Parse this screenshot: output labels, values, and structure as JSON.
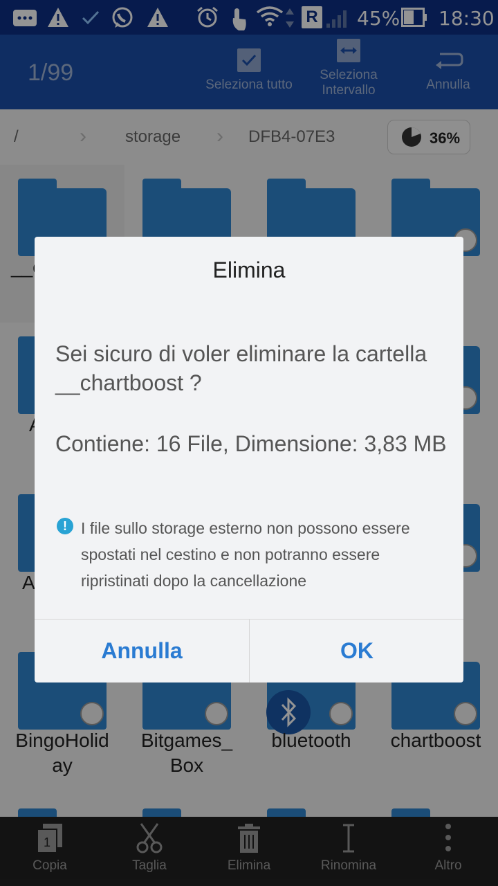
{
  "status_bar": {
    "battery": "45%",
    "time": "18:30",
    "roaming": "R",
    "icons": [
      "message-icon",
      "warning-icon",
      "check-icon",
      "whatsapp-icon",
      "warning-icon",
      "alarm-icon",
      "touch-icon",
      "wifi-icon",
      "roaming-icon",
      "signal-icon",
      "battery-icon"
    ]
  },
  "toolbar": {
    "counter": "1/99",
    "select_all": "Seleziona tutto",
    "select_range_line1": "Seleziona",
    "select_range_line2": "Intervallo",
    "cancel": "Annulla"
  },
  "breadcrumb": {
    "root": "/",
    "items": [
      "storage",
      "DFB4-07E3"
    ],
    "usage": "36%"
  },
  "grid": {
    "row1": [
      {
        "label": "__c",
        "icon": "folder-icon",
        "selected": true
      },
      {
        "label": "",
        "icon": "folder-icon"
      },
      {
        "label": "",
        "icon": "folder-icon"
      },
      {
        "label": "",
        "icon": "folder-icon"
      }
    ],
    "row2_left": "A",
    "row3_left": "A",
    "row4": [
      {
        "label_line1": "BingoHolid",
        "label_line2": "ay"
      },
      {
        "label_line1": "Bitgames_",
        "label_line2": "Box"
      },
      {
        "label_line1": "bluetooth",
        "label_line2": ""
      },
      {
        "label_line1": "chartboost",
        "label_line2": ""
      }
    ]
  },
  "bottom_bar": {
    "copy": "Copia",
    "cut": "Taglia",
    "delete": "Elimina",
    "rename": "Rinomina",
    "more": "Altro"
  },
  "dialog": {
    "title": "Elimina",
    "message": "Sei sicuro di voler eliminare la cartella __chartboost ?",
    "info": "Contiene: 16 File, Dimensione: 3,83 MB",
    "note": "I file sullo storage esterno non possono essere spostati nel cestino e non potranno essere ripristinati dopo la cancellazione",
    "cancel": "Annulla",
    "ok": "OK"
  },
  "colors": {
    "statusbar": "#0d2f86",
    "toolbar": "#1b4ea9",
    "folder": "#2f86cf",
    "accent": "#2a7bd2",
    "info_icon": "#29a3d4"
  }
}
